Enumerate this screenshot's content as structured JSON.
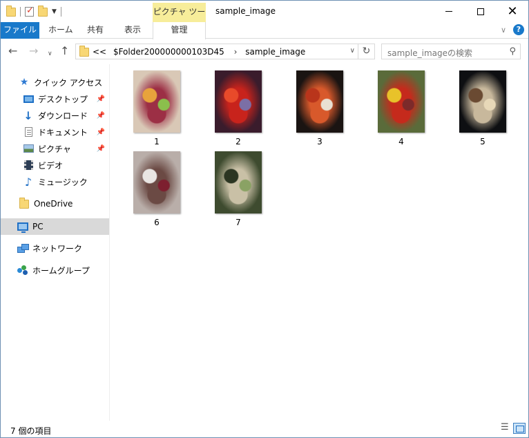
{
  "window": {
    "title": "sample_image",
    "context_tab": "ピクチャ ツール"
  },
  "ribbon": {
    "tabs": [
      "ファイル",
      "ホーム",
      "共有",
      "表示"
    ],
    "manage": "管理"
  },
  "address": {
    "overflow": "<<",
    "crumbs": [
      "$Folder200000000103D45",
      "sample_image"
    ]
  },
  "search": {
    "placeholder": "sample_imageの検索"
  },
  "nav": {
    "quick_access": "クイック アクセス",
    "items": [
      "デスクトップ",
      "ダウンロード",
      "ドキュメント",
      "ピクチャ",
      "ビデオ",
      "ミュージック"
    ],
    "onedrive": "OneDrive",
    "pc": "PC",
    "network": "ネットワーク",
    "homegroup": "ホームグループ"
  },
  "files": [
    {
      "name": "1",
      "colors": [
        "#d9c8b6",
        "#9c2f45",
        "#e8a33c",
        "#8bbf4c"
      ]
    },
    {
      "name": "2",
      "colors": [
        "#3a1c2c",
        "#c8231c",
        "#e84a2a",
        "#7b6fa6"
      ]
    },
    {
      "name": "3",
      "colors": [
        "#1a1412",
        "#d8592b",
        "#b9351b",
        "#e9e0d2"
      ]
    },
    {
      "name": "4",
      "colors": [
        "#5a6b3a",
        "#c52a1c",
        "#e8c22a",
        "#7c2a2a"
      ]
    },
    {
      "name": "5",
      "colors": [
        "#0e0f12",
        "#c8b89c",
        "#6a4a32",
        "#e7d8b8"
      ]
    },
    {
      "name": "6",
      "colors": [
        "#b9aea9",
        "#6b4a44",
        "#e9e6e3",
        "#7d1f2f"
      ]
    },
    {
      "name": "7",
      "colors": [
        "#3e4b2f",
        "#c9c0a6",
        "#2b3522",
        "#8aa264"
      ]
    }
  ],
  "status": {
    "count": "7 個の項目"
  },
  "icons": {
    "back": "arrow-left-icon",
    "forward": "arrow-right-icon",
    "up": "arrow-up-icon",
    "refresh": "refresh-icon",
    "search": "search-icon",
    "help": "help-icon"
  }
}
